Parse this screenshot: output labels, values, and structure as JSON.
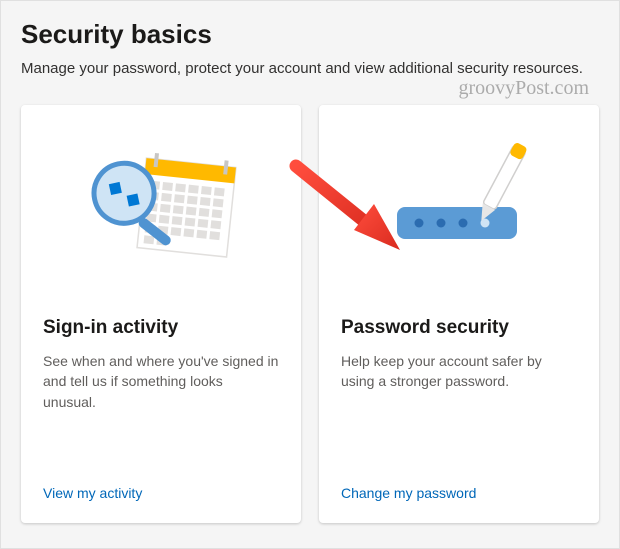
{
  "header": {
    "title": "Security basics",
    "subtitle": "Manage your password, protect your account and view additional security resources."
  },
  "watermark": "groovyPost.com",
  "cards": [
    {
      "title": "Sign-in activity",
      "description": "See when and where you've signed in and tell us if something looks unusual.",
      "link_label": "View my activity"
    },
    {
      "title": "Password security",
      "description": "Help keep your account safer by using a stronger password.",
      "link_label": "Change my password"
    }
  ]
}
